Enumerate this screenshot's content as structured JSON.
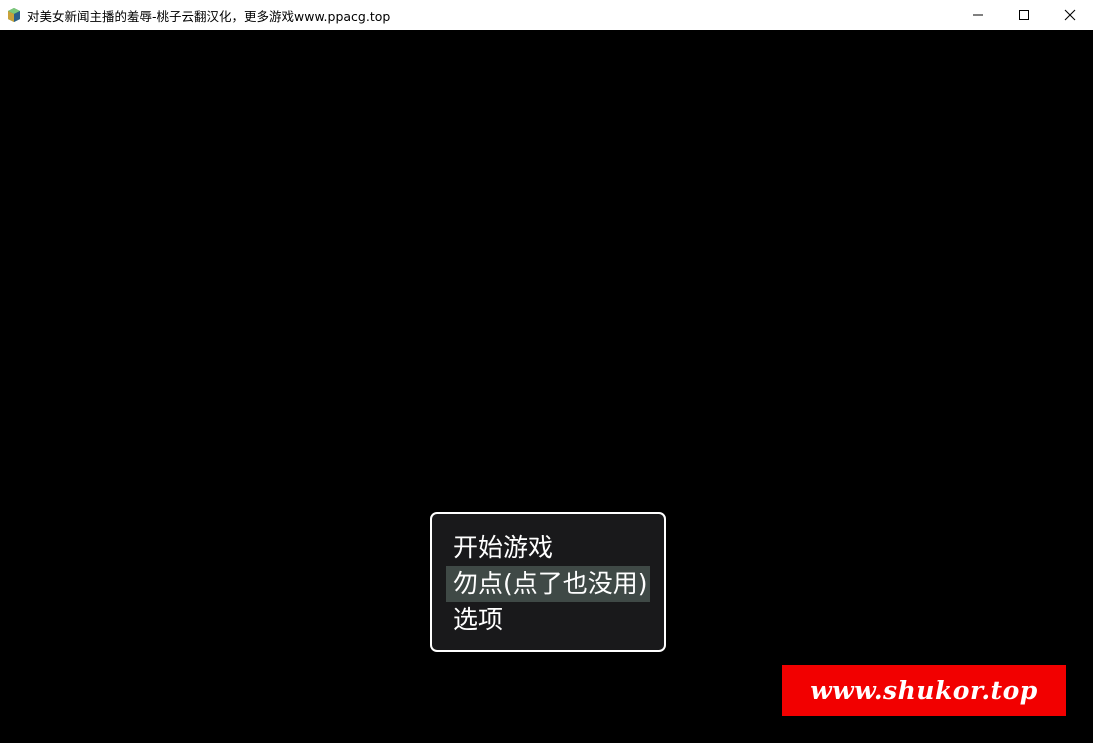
{
  "window": {
    "title": "对美女新闻主播的羞辱-桃子云翻汉化，更多游戏www.ppacg.top",
    "icon": "game-app-icon",
    "controls": {
      "minimize": "minimize-icon",
      "maximize": "maximize-icon",
      "close": "close-icon"
    }
  },
  "title_menu": {
    "items": [
      {
        "label": "开始游戏",
        "selected": false
      },
      {
        "label": "勿点(点了也没用)",
        "selected": true
      },
      {
        "label": "选项",
        "selected": false
      }
    ],
    "highlight_color": "#3f4946",
    "background_color": "#19191b",
    "border_color": "#ffffff"
  },
  "watermark": {
    "text": "www.shukor.top",
    "background_color": "#f20000",
    "text_color": "#ffffff"
  }
}
